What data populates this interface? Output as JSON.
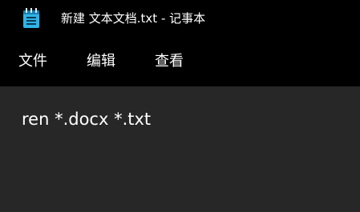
{
  "window": {
    "title": "新建 文本文档.txt - 记事本",
    "icon": "notepad-icon"
  },
  "menu": {
    "file_label": "文件",
    "edit_label": "编辑",
    "view_label": "查看"
  },
  "editor": {
    "content": "ren *.docx *.txt"
  },
  "colors": {
    "titlebar_bg": "#000000",
    "editor_bg": "#272727",
    "text": "#ffffff",
    "icon_accent": "#2fb3e6"
  }
}
